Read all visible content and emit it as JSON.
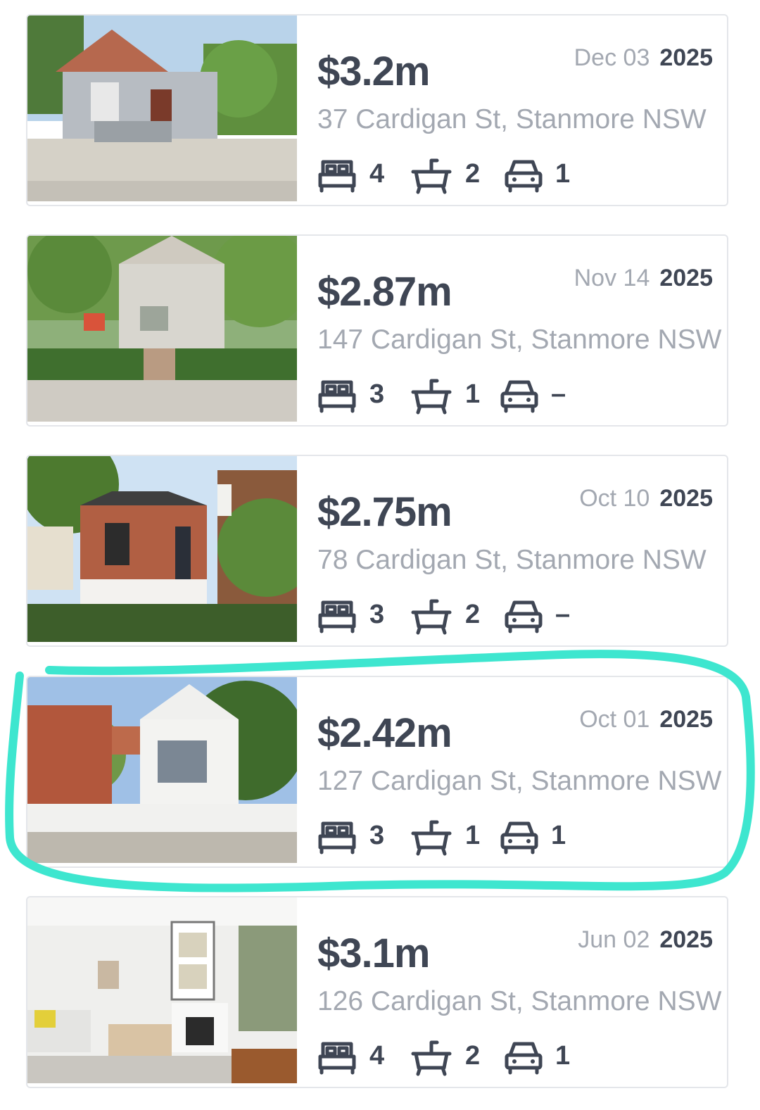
{
  "listings": [
    {
      "price": "$3.2m",
      "date_md": "Dec 03",
      "year": "2025",
      "address": "37 Cardigan St, Stanmore NSW",
      "beds": "4",
      "baths": "2",
      "cars": "1"
    },
    {
      "price": "$2.87m",
      "date_md": "Nov 14",
      "year": "2025",
      "address": "147 Cardigan St, Stanmore NSW",
      "beds": "3",
      "baths": "1",
      "cars": "–"
    },
    {
      "price": "$2.75m",
      "date_md": "Oct 10",
      "year": "2025",
      "address": "78 Cardigan St, Stanmore NSW",
      "beds": "3",
      "baths": "2",
      "cars": "–"
    },
    {
      "price": "$2.42m",
      "date_md": "Oct 01",
      "year": "2025",
      "address": "127 Cardigan St, Stanmore NSW",
      "beds": "3",
      "baths": "1",
      "cars": "1"
    },
    {
      "price": "$3.1m",
      "date_md": "Jun 02",
      "year": "2025",
      "address": "126 Cardigan St, Stanmore NSW",
      "beds": "4",
      "baths": "2",
      "cars": "1"
    }
  ],
  "icons": {
    "bed": "bed-icon",
    "bath": "bath-icon",
    "car": "car-icon"
  },
  "colors": {
    "text_dark": "#3f4654",
    "text_muted": "#a3a8b1",
    "card_border": "#e4e6ea",
    "highlight": "#3ee6cf"
  }
}
